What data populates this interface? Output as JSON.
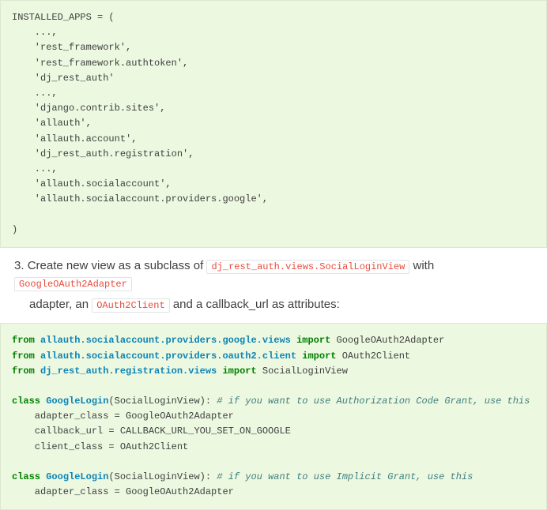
{
  "code1": {
    "l0": "INSTALLED_APPS = (",
    "l1": "    ...,",
    "l2": "    'rest_framework',",
    "l3": "    'rest_framework.authtoken',",
    "l4": "    'dj_rest_auth'",
    "l5": "    ...,",
    "l6": "    'django.contrib.sites',",
    "l7": "    'allauth',",
    "l8": "    'allauth.account',",
    "l9": "    'dj_rest_auth.registration',",
    "l10": "    ...,",
    "l11": "    'allauth.socialaccount',",
    "l12": "    'allauth.socialaccount.providers.google',",
    "l13": "",
    "l14": ")"
  },
  "step": {
    "num": "3.",
    "part1": "Create new view as a subclass of ",
    "ic1": "dj_rest_auth.views.SocialLoginView",
    "part2": " with ",
    "ic2": "GoogleOAuth2Adapter",
    "part3": "adapter, an ",
    "ic3": "OAuth2Client",
    "part4": " and a callback_url as attributes:"
  },
  "code2": {
    "l0_k1": "from",
    "l0_m": "allauth.socialaccount.providers.google.views",
    "l0_k2": "import",
    "l0_n": "GoogleOAuth2Adapter",
    "l1_k1": "from",
    "l1_m": "allauth.socialaccount.providers.oauth2.client",
    "l1_k2": "import",
    "l1_n": "OAuth2Client",
    "l2_k1": "from",
    "l2_m": "dj_rest_auth.registration.views",
    "l2_k2": "import",
    "l2_n": "SocialLoginView",
    "l3": "",
    "l4_k": "class",
    "l4_nc": "GoogleLogin",
    "l4_p": "(SocialLoginView): ",
    "l4_c": "# if you want to use Authorization Code Grant, use this",
    "l5": "    adapter_class = GoogleOAuth2Adapter",
    "l6": "    callback_url = CALLBACK_URL_YOU_SET_ON_GOOGLE",
    "l7": "    client_class = OAuth2Client",
    "l8": "",
    "l9_k": "class",
    "l9_nc": "GoogleLogin",
    "l9_p": "(SocialLoginView): ",
    "l9_c": "# if you want to use Implicit Grant, use this",
    "l10": "    adapter_class = GoogleOAuth2Adapter"
  }
}
